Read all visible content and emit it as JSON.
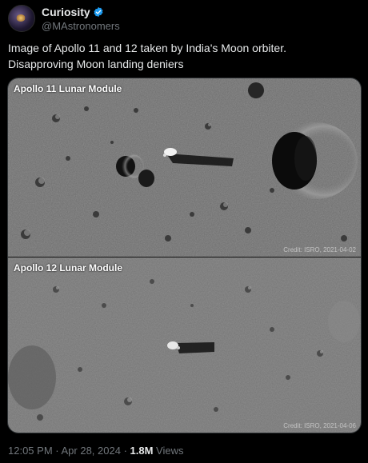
{
  "author": {
    "display_name": "Curiosity",
    "handle": "@MAstronomers",
    "verified_icon": "verified-badge-icon",
    "badge_color": "#1d9bf0"
  },
  "tweet": {
    "text": "Image of Apollo 11 and 12 taken by India's Moon orbiter. Disapproving Moon landing deniers"
  },
  "media": {
    "panels": [
      {
        "title": "Apollo 11 Lunar Module",
        "credit": "Credit: ISRO, 2021-04-02"
      },
      {
        "title": "Apollo 12 Lunar Module",
        "credit": "Credit: ISRO, 2021-04-06"
      }
    ]
  },
  "meta": {
    "time": "12:05 PM",
    "separator": " · ",
    "date": "Apr 28, 2024",
    "views_count": "1.8M",
    "views_label": "Views"
  }
}
